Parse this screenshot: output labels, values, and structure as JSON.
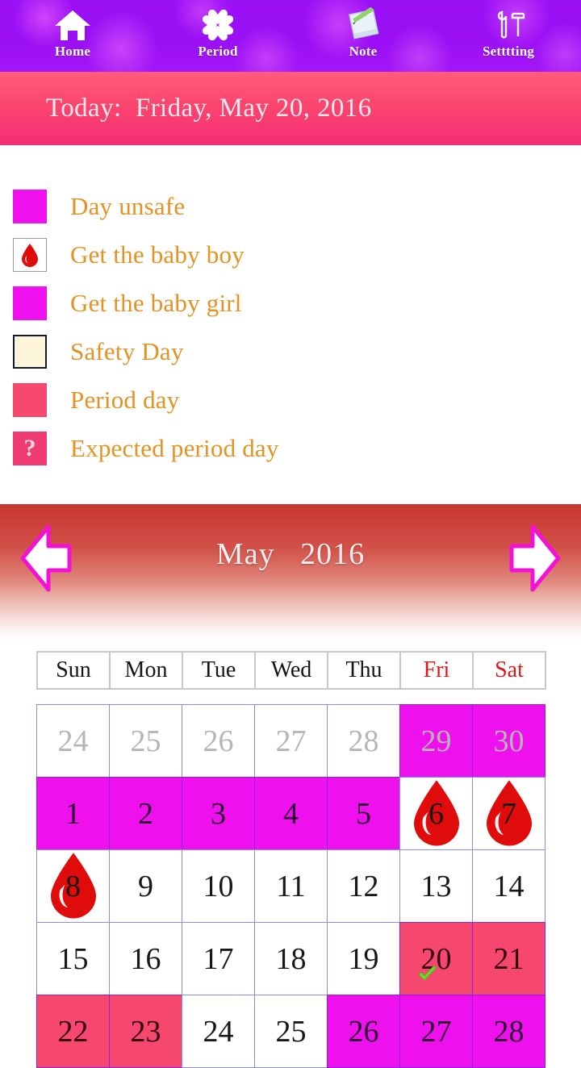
{
  "nav": {
    "items": [
      {
        "label": "Home",
        "icon": "home-icon"
      },
      {
        "label": "Period",
        "icon": "flower-heart-icon"
      },
      {
        "label": "Note",
        "icon": "note-pen-icon"
      },
      {
        "label": "Setttting",
        "icon": "tools-icon"
      }
    ]
  },
  "today_bar": {
    "text": "Today:  Friday, May 20, 2016",
    "label": "Today:",
    "date": "Friday, May 20, 2016"
  },
  "legend": {
    "items": [
      {
        "label": "Day unsafe",
        "swatch": "magenta",
        "icon": ""
      },
      {
        "label": "Get the baby boy",
        "swatch": "white",
        "icon": "blood-drop-icon"
      },
      {
        "label": "Get the baby girl",
        "swatch": "magenta",
        "icon": ""
      },
      {
        "label": "Safety Day",
        "swatch": "cream",
        "icon": ""
      },
      {
        "label": "Period day",
        "swatch": "pink",
        "icon": ""
      },
      {
        "label": "Expected period day",
        "swatch": "qpink",
        "icon": "question-mark"
      }
    ]
  },
  "month_nav": {
    "title": "May   2016",
    "month": "May",
    "year": "2016",
    "prev_label": "prev-month",
    "next_label": "next-month"
  },
  "calendar": {
    "weekdays": [
      {
        "label": "Sun",
        "weekend": false
      },
      {
        "label": "Mon",
        "weekend": false
      },
      {
        "label": "Tue",
        "weekend": false
      },
      {
        "label": "Wed",
        "weekend": false
      },
      {
        "label": "Thu",
        "weekend": false
      },
      {
        "label": "Fri",
        "weekend": true
      },
      {
        "label": "Sat",
        "weekend": true
      }
    ],
    "rows": [
      [
        {
          "day": "24",
          "state": "other"
        },
        {
          "day": "25",
          "state": "other"
        },
        {
          "day": "26",
          "state": "other"
        },
        {
          "day": "27",
          "state": "other"
        },
        {
          "day": "28",
          "state": "other"
        },
        {
          "day": "29",
          "state": "other unsafe"
        },
        {
          "day": "30",
          "state": "other unsafe"
        }
      ],
      [
        {
          "day": "1",
          "state": "unsafe"
        },
        {
          "day": "2",
          "state": "unsafe"
        },
        {
          "day": "3",
          "state": "unsafe"
        },
        {
          "day": "4",
          "state": "unsafe"
        },
        {
          "day": "5",
          "state": "unsafe"
        },
        {
          "day": "6",
          "state": "safe",
          "drop": true
        },
        {
          "day": "7",
          "state": "safe",
          "drop": true
        }
      ],
      [
        {
          "day": "8",
          "state": "safe",
          "drop": true
        },
        {
          "day": "9",
          "state": "safe"
        },
        {
          "day": "10",
          "state": "safe"
        },
        {
          "day": "11",
          "state": "safe"
        },
        {
          "day": "12",
          "state": "safe"
        },
        {
          "day": "13",
          "state": "safe"
        },
        {
          "day": "14",
          "state": "safe"
        }
      ],
      [
        {
          "day": "15",
          "state": "safe"
        },
        {
          "day": "16",
          "state": "safe"
        },
        {
          "day": "17",
          "state": "safe"
        },
        {
          "day": "18",
          "state": "safe"
        },
        {
          "day": "19",
          "state": "safe"
        },
        {
          "day": "20",
          "state": "period",
          "today": true
        },
        {
          "day": "21",
          "state": "period"
        }
      ],
      [
        {
          "day": "22",
          "state": "period"
        },
        {
          "day": "23",
          "state": "period"
        },
        {
          "day": "24",
          "state": "safe"
        },
        {
          "day": "25",
          "state": "safe"
        },
        {
          "day": "26",
          "state": "unsafe"
        },
        {
          "day": "27",
          "state": "unsafe"
        },
        {
          "day": "28",
          "state": "unsafe"
        }
      ]
    ]
  },
  "colors": {
    "nav_purple": "#9b11f5",
    "today_pink": "#fb476e",
    "legend_text": "#e49224",
    "unsafe_magenta": "#ee11ee",
    "period_pink": "#f6476f",
    "safety_cream": "#fdf6da",
    "grid_border": "#8d8de0",
    "weekend_red": "#e01717",
    "drop_red": "#e00b0b",
    "check_green": "#6ddb2a"
  }
}
